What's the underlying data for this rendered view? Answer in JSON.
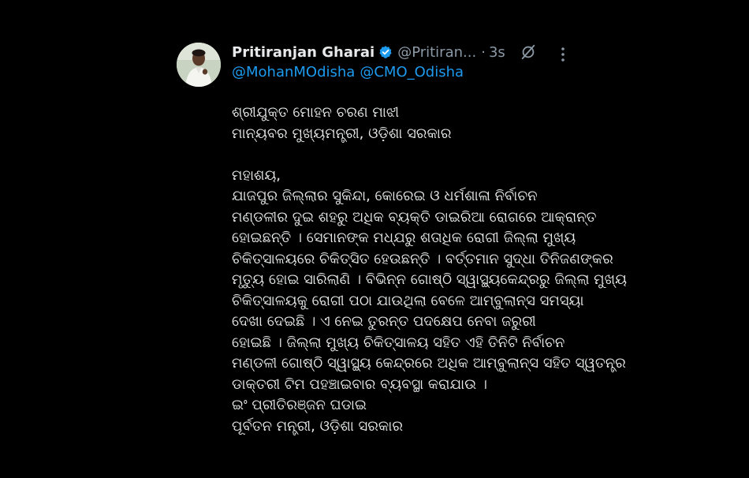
{
  "tweet": {
    "author_name": "Pritiranjan Gharai",
    "author_handle": "@Pritiran...",
    "timestamp": "3s",
    "separator": "·",
    "mentions": [
      "@MohanMOdisha",
      "@CMO_Odisha"
    ],
    "body_lines": [
      "ଶ୍ରୀଯୁକ୍ତ ମୋହନ ଚରଣ ମାଝୀ",
      "ମାନ୍ୟବର ମୁଖ୍ୟମନ୍ତ୍ରୀ, ଓଡ଼ିଶା ସରକାର",
      "",
      "ମହାଶୟ,",
      "ଯାଜପୁର ଜିଲ୍ଲାର ସୁକିନ୍ଦା, କୋରେଇ ଓ ଧର୍ମଶାଳା ନିର୍ବାଚନ",
      "ମଣ୍ଡଳୀର ଦୁଇ ଶହରୁ ଅଧିକ ବ୍ୟକ୍ତି ଡାଇରିଆ ରୋଗରେ ଆକ୍ରାନ୍ତ",
      "ହୋଇଛନ୍ତି । ସେମାନଙ୍କ ମଧ୍ଯରୁ ଶତାଧିକ ରୋଗୀ ଜିଲ୍ଲା ମୁଖ୍ୟ",
      "ଚିକିତ୍ସାଳୟରେ ଚିକିତ୍ସିତ ହେଉଛନ୍ତି । ବର୍ତ୍ତମାନ ସୁଦ୍ଧା ତିନିଜଣଙ୍କର",
      "ମୃତ୍ୟୁ ହୋଇ ସାରିଲାଣି । ବିଭିନ୍ନ ଗୋଷ୍ଠି ସ୍ୱାସ୍ଥ୍ୟକେନ୍ଦ୍ରରୁ ଜିଲ୍ଲା ମୁଖ୍ୟ",
      "ଚିକିତ୍ସାଳୟକୁ ରୋଗୀ ପଠା ଯାଉଥିଲା ବେଳେ ଆମ୍ବୁଲାନ୍ସ ସମସ୍ୟା",
      "ଦେଖା ଦେଇଛି । ଏ ନେଇ ତୁରନ୍ତ ପଦକ୍ଷେପ ନେବା ଜରୁରୀ",
      "ହୋଇଛି । ଜିଲ୍ଲା ମୁଖ୍ୟ ଚିକିତ୍ସାଳୟ ସହିତ ଏହି ତିନିଟି ନିର୍ବାଚନ",
      "ମଣ୍ଡଳୀ ଗୋଷ୍ଠି ସ୍ୱାସ୍ଥ୍ୟ କେନ୍ଦ୍ରରେ ଅଧିକ ଆମ୍ବୁଲାନ୍ସ ସହିତ ସ୍ୱତନ୍ତ୍ର",
      "ଡାକ୍ତରୀ ଟିମ ପହଞ୍ଚାଇବାର ବ୍ୟବସ୍ଥା କରାଯାଉ ।",
      "ଇଂ ପ୍ରୀତିରଞ୍ଜନ ଘଡାଇ",
      "ପୂର୍ବତନ ମନ୍ତ୍ରୀ, ଓଡ଼ିଶା ସରକାର"
    ]
  },
  "icons": {
    "verified": "verified-badge-icon",
    "grok": "grok-icon",
    "more": "more-options-icon"
  },
  "colors": {
    "background": "#000000",
    "text": "#e7e9ea",
    "secondary_text": "#8b98a5",
    "link": "#1d9bf0",
    "verified": "#1d9bf0"
  }
}
